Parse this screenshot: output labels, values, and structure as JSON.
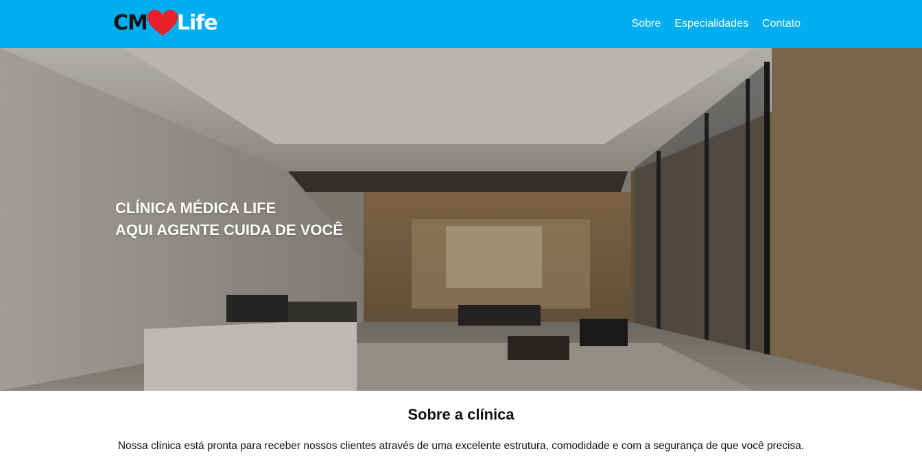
{
  "brand": {
    "part1": "CM",
    "part2": "Life",
    "heart_color": "#e8202a",
    "header_color": "#00aeef"
  },
  "nav": {
    "items": [
      {
        "label": "Sobre"
      },
      {
        "label": "Especialidades"
      },
      {
        "label": "Contato"
      }
    ]
  },
  "hero": {
    "line1": "CLÍNICA MÉDICA LIFE",
    "line2": "AQUI AGENTE CUIDA DE VOCÊ"
  },
  "about": {
    "title": "Sobre a clínica",
    "text": "Nossa clínica está pronta para receber nossos clientes através de uma excelente estrutura, comodidade e com a segurança de que você precisa."
  }
}
